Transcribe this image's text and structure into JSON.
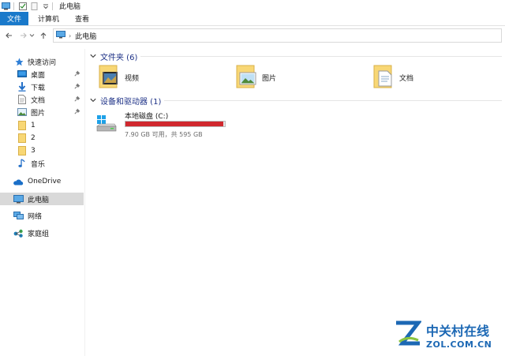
{
  "titlebar": {
    "title": "此电脑"
  },
  "ribbon": {
    "tabs": [
      "文件",
      "计算机",
      "查看"
    ]
  },
  "address": {
    "path": "此电脑"
  },
  "nav": {
    "quick_access": "快速访问",
    "quick_items": [
      {
        "label": "桌面",
        "icon": "desktop-icon",
        "pinned": true
      },
      {
        "label": "下载",
        "icon": "download-icon",
        "pinned": true
      },
      {
        "label": "文档",
        "icon": "documents-icon",
        "pinned": true
      },
      {
        "label": "图片",
        "icon": "pictures-icon",
        "pinned": true
      },
      {
        "label": "1",
        "icon": "folder-icon",
        "pinned": false
      },
      {
        "label": "2",
        "icon": "folder-icon",
        "pinned": false
      },
      {
        "label": "3",
        "icon": "folder-icon",
        "pinned": false
      },
      {
        "label": "音乐",
        "icon": "music-icon",
        "pinned": false
      }
    ],
    "onedrive": "OneDrive",
    "this_pc": "此电脑",
    "network": "网络",
    "homegroup": "家庭组"
  },
  "content": {
    "folders_header": "文件夹 (6)",
    "folders": [
      {
        "label": "视频",
        "icon": "videos-folder-icon"
      },
      {
        "label": "图片",
        "icon": "pictures-folder-icon"
      },
      {
        "label": "文档",
        "icon": "documents-folder-icon"
      }
    ],
    "devices_header": "设备和驱动器 (1)",
    "drive": {
      "name": "本地磁盘 (C:)",
      "info": "7.90 GB 可用，共 595 GB",
      "used_fraction": 0.987,
      "bar_color": "#d0282e"
    }
  },
  "watermark": {
    "cn": "中关村在线",
    "en": "ZOL.COM.CN"
  },
  "colors": {
    "accent": "#1979ca",
    "header_text": "#1e3287",
    "selected": "#d9d9d9"
  }
}
